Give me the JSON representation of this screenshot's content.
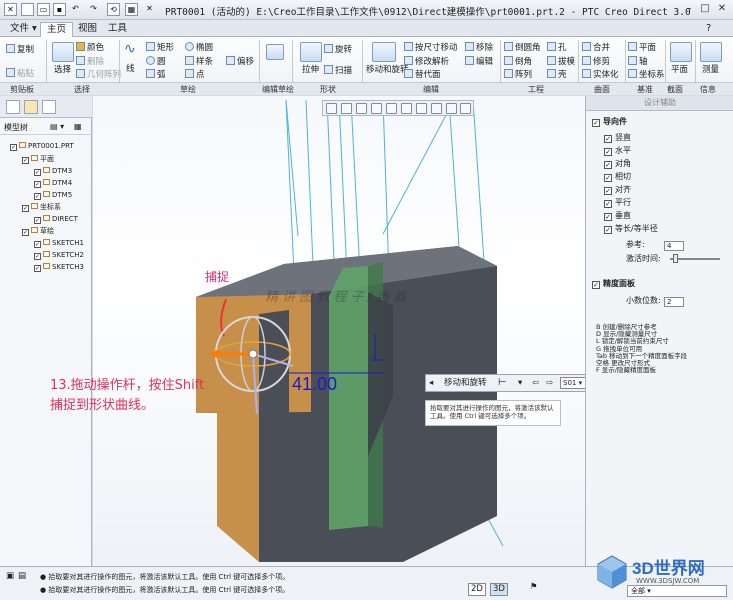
{
  "window": {
    "title": "PRT0001 (活动的) E:\\Creo工作目录\\工作文件\\0912\\Direct建模操作\\prt0001.prt.2 - PTC Creo Direct 3.0"
  },
  "tabs": [
    {
      "label": "文件 ▾"
    },
    {
      "label": "主页"
    },
    {
      "label": "视图"
    },
    {
      "label": "工具"
    }
  ],
  "ribbon": {
    "clipboard": {
      "copy": "复制",
      "paste": "粘贴",
      "group": "剪贴板"
    },
    "select": {
      "select": "选择",
      "color": "颜色",
      "delete": "删除",
      "geom_pattern": "几何阵列",
      "group": "选择"
    },
    "sketch": {
      "line": "线",
      "rect": "矩形",
      "ellipse": "椭圆",
      "arc": "弧",
      "spline": "样条",
      "circle": "圆",
      "offset": "偏移",
      "point": "点",
      "group": "草绘"
    },
    "edit_sketch": {
      "group": "编辑草绘"
    },
    "shape": {
      "extrude": "拉伸",
      "revolve": "旋转",
      "sweep": "扫描",
      "group": "形状"
    },
    "edit": {
      "move_rotate": "移动和旋转",
      "move_by_dim": "按尺寸移动",
      "move": "移除",
      "modify_analytic": "修改解析",
      "replace": "替代面",
      "edit_item": "编辑",
      "group": "编辑"
    },
    "engineering": {
      "round": "倒圆角",
      "chamfer": "倒角",
      "pattern": "阵列",
      "hole": "孔",
      "draft": "拔模",
      "shell": "壳",
      "group": "工程"
    },
    "surface": {
      "merge": "合并",
      "trim": "修剪",
      "solidify": "实体化",
      "group": "曲面"
    },
    "datum": {
      "plane": "平面",
      "axis": "轴",
      "csys": "坐标系",
      "group": "基准"
    },
    "section": {
      "plane": "平面",
      "group": "截面"
    },
    "info": {
      "measure": "测量",
      "group": "信息"
    }
  },
  "model_tree": {
    "header": "模型树",
    "items": [
      {
        "label": "PRT0001.PRT",
        "indent": 0
      },
      {
        "label": "平面",
        "indent": 1
      },
      {
        "label": "DTM3",
        "indent": 2
      },
      {
        "label": "DTM4",
        "indent": 2
      },
      {
        "label": "DTM5",
        "indent": 2
      },
      {
        "label": "坐标系",
        "indent": 1
      },
      {
        "label": "DIRECT",
        "indent": 2
      },
      {
        "label": "草绘",
        "indent": 1
      },
      {
        "label": "SKETCH1",
        "indent": 2
      },
      {
        "label": "SKETCH2",
        "indent": 2
      },
      {
        "label": "SKETCH3",
        "indent": 2
      }
    ]
  },
  "design_assist": {
    "title": "设计辅助",
    "guides": "导向件",
    "options": [
      "竖直",
      "水平",
      "对角",
      "相切",
      "对齐",
      "平行",
      "垂直",
      "等长/等半径"
    ],
    "reference_label": "参考:",
    "reference_value": "4",
    "snap_time_label": "激活时间:",
    "precision_panel": "精度面板",
    "decimals_label": "小数位数:",
    "decimals_value": "2",
    "shortcuts": [
      "B 创建/删除尺寸参考",
      "D 显示/隐藏测量尺寸",
      "L 锁定/解锁当前约束尺寸",
      "G 拖拽单位可用",
      "Tab 移动到下一个精度面板字段",
      "空格 更改尺寸形式",
      "F 显示/隐藏精度面板"
    ]
  },
  "move_dialog": {
    "title": "移动和旋转",
    "field": "S01",
    "tip": "拾取要对其进行操作的图元，将激活该默认工具。使用 Ctrl 键可选择多个项。"
  },
  "viewport": {
    "dimension_value": "41.00",
    "snap_label": "捕捉",
    "caption_line1": "13.拖动操作杆，按住Shift",
    "caption_line2": "捕捉到形状曲线。",
    "watermark": "精 讲 图 教 程 子 / 冉 鑫"
  },
  "status": {
    "line1": "● 拾取要对其进行操作的图元，将激活该默认工具。使用 Ctrl 键可选择多个项。",
    "line2": "● 拾取要对其进行操作的图元，将激活该默认工具。使用 Ctrl 键可选择多个项。",
    "mode_2d": "2D",
    "mode_3d": "3D",
    "filter": "全部"
  },
  "brand": {
    "name": "3D世界网",
    "url": "WWW.3DSJW.COM"
  },
  "colors": {
    "accent": "#2d6cc0",
    "body_dark": "#4a4e57",
    "face_tan": "#c7904a",
    "face_green": "#5fa86a",
    "dimension": "#1b1bc8",
    "caption": "#e0305a"
  }
}
